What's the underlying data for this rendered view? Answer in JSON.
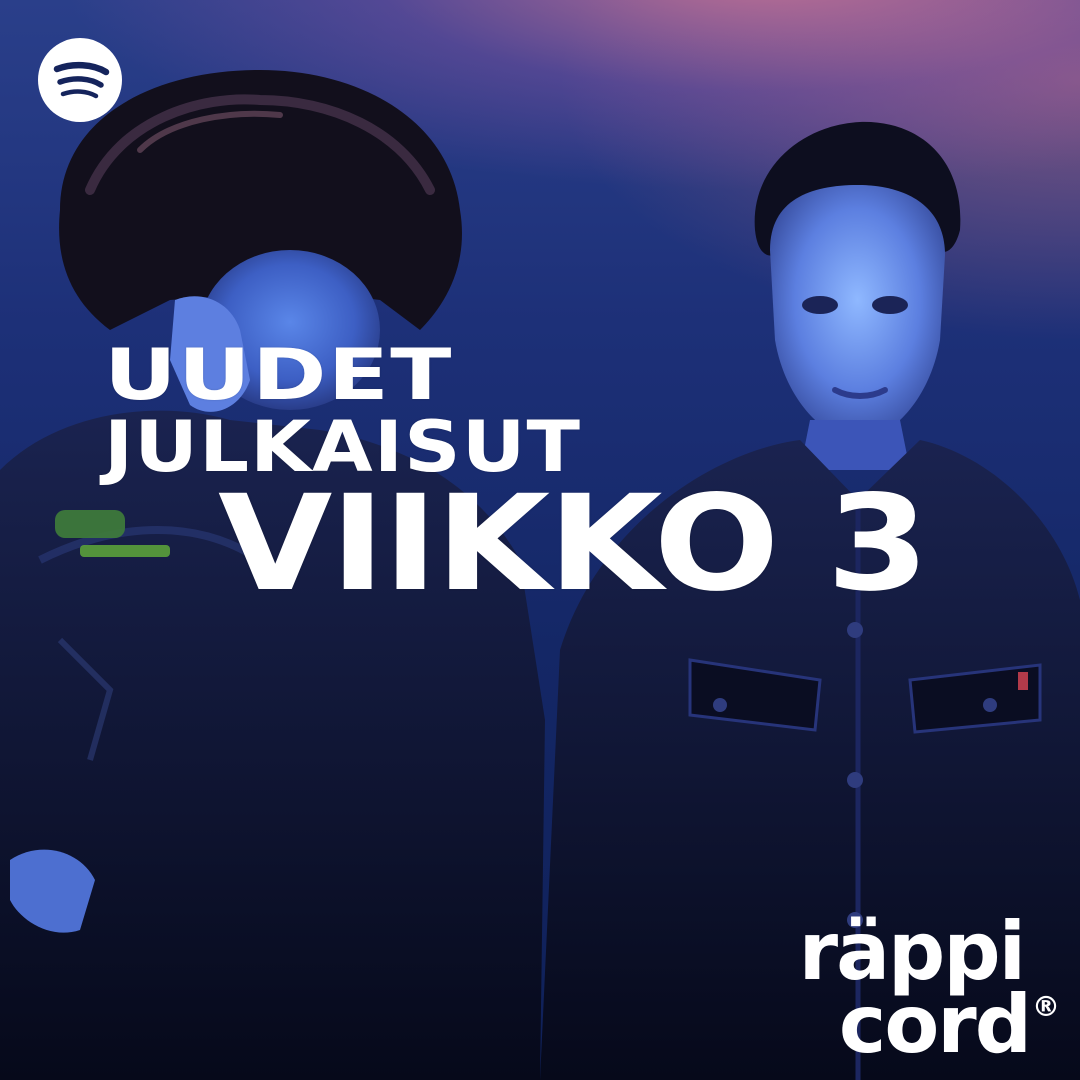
{
  "headline": {
    "line1": "UUDET",
    "line2": "JULKAISUT",
    "line3": "VIIKKO 3"
  },
  "brand": {
    "line1": "räppi",
    "line2": "cord",
    "registered_mark": "®"
  },
  "logo": {
    "icon": "spotify-icon"
  },
  "colors": {
    "background_top": "#2a3f8a",
    "background_bottom": "#0f2058",
    "glow": "#d67896",
    "text": "#ffffff",
    "jacket": "#0a0f24"
  }
}
